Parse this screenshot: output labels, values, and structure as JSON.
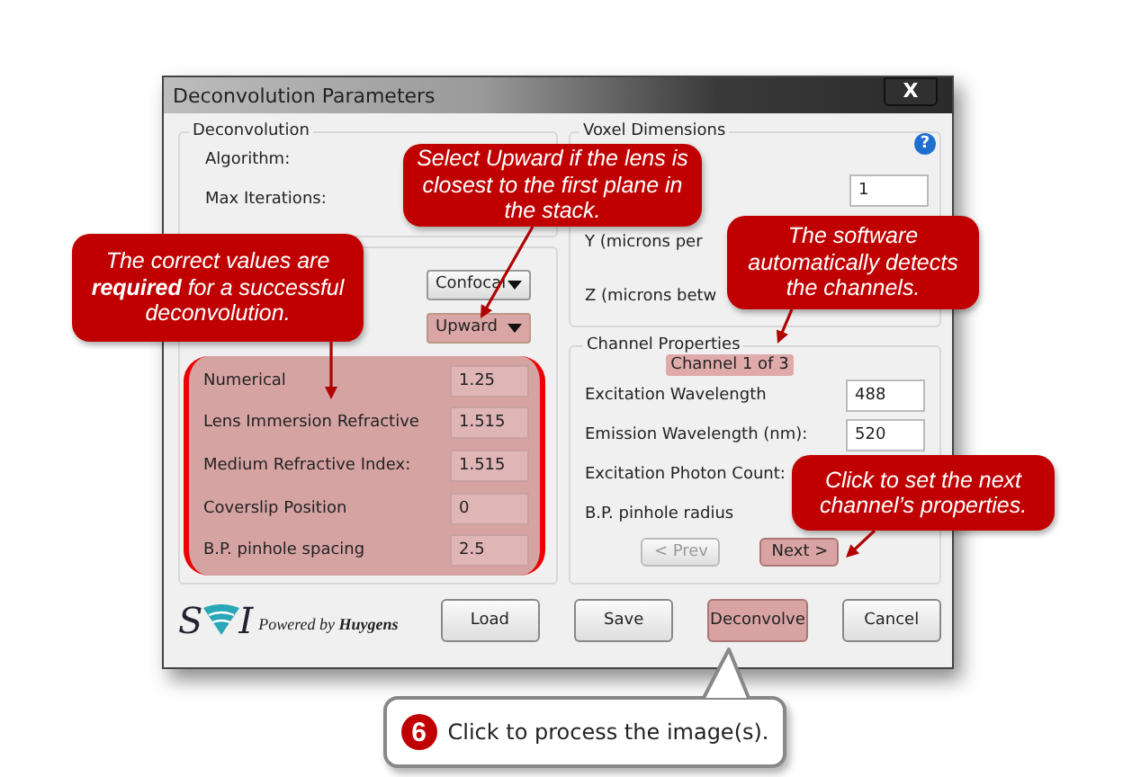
{
  "window": {
    "title": "Deconvolution Parameters",
    "close": "X"
  },
  "deconvolution": {
    "title": "Deconvolution",
    "fields": [
      {
        "label": "Algorithm:"
      },
      {
        "label": "Max Iterations:"
      }
    ]
  },
  "microscope": {
    "dropdowns": [
      {
        "value": "Confocal",
        "highlighted": false
      },
      {
        "value": "Upward",
        "highlighted": true
      }
    ],
    "fields": [
      {
        "label": "Numerical",
        "value": "1.25"
      },
      {
        "label": "Lens Immersion Refractive",
        "value": "1.515"
      },
      {
        "label": "Medium Refractive Index:",
        "value": "1.515"
      },
      {
        "label": "Coverslip Position",
        "value": "0"
      },
      {
        "label": "B.P. pinhole spacing",
        "value": "2.5"
      }
    ]
  },
  "voxel": {
    "title": "Voxel Dimensions",
    "help": "?",
    "x_value": "1",
    "labels": [
      "Y (microns per",
      "Z (microns betw"
    ]
  },
  "channel": {
    "title": "Channel Properties",
    "indicator": "Channel 1 of 3",
    "fields": [
      {
        "label": "Excitation Wavelength",
        "value": "488"
      },
      {
        "label": "Emission Wavelength (nm):",
        "value": "520"
      },
      {
        "label": "Excitation Photon Count:"
      },
      {
        "label": "B.P. pinhole radius"
      }
    ],
    "nav": [
      {
        "label": "< Prev",
        "disabled": true,
        "highlighted": false
      },
      {
        "label": "Next  >",
        "disabled": false,
        "highlighted": true
      }
    ]
  },
  "logo": {
    "left": "S",
    "right": "I",
    "text": "Powered by **Huygens**"
  },
  "buttons": [
    {
      "label": "Load",
      "highlighted": false
    },
    {
      "label": "Save",
      "highlighted": false
    },
    {
      "label": "Deconvolve",
      "highlighted": true
    },
    {
      "label": "Cancel",
      "highlighted": false
    }
  ],
  "callouts": [
    {
      "kind": "red",
      "text": "*Select* Upward *if the lens is closest to the first plane in the stack.*"
    },
    {
      "kind": "red",
      "text": "The correct values are **required** for a successful deconvolution."
    },
    {
      "kind": "red",
      "text": "The software automatically detects the channels."
    },
    {
      "kind": "red",
      "text": "Click to set the next channel’s properties."
    },
    {
      "kind": "step",
      "number": "6",
      "text": "Click to process the image(s)."
    }
  ]
}
